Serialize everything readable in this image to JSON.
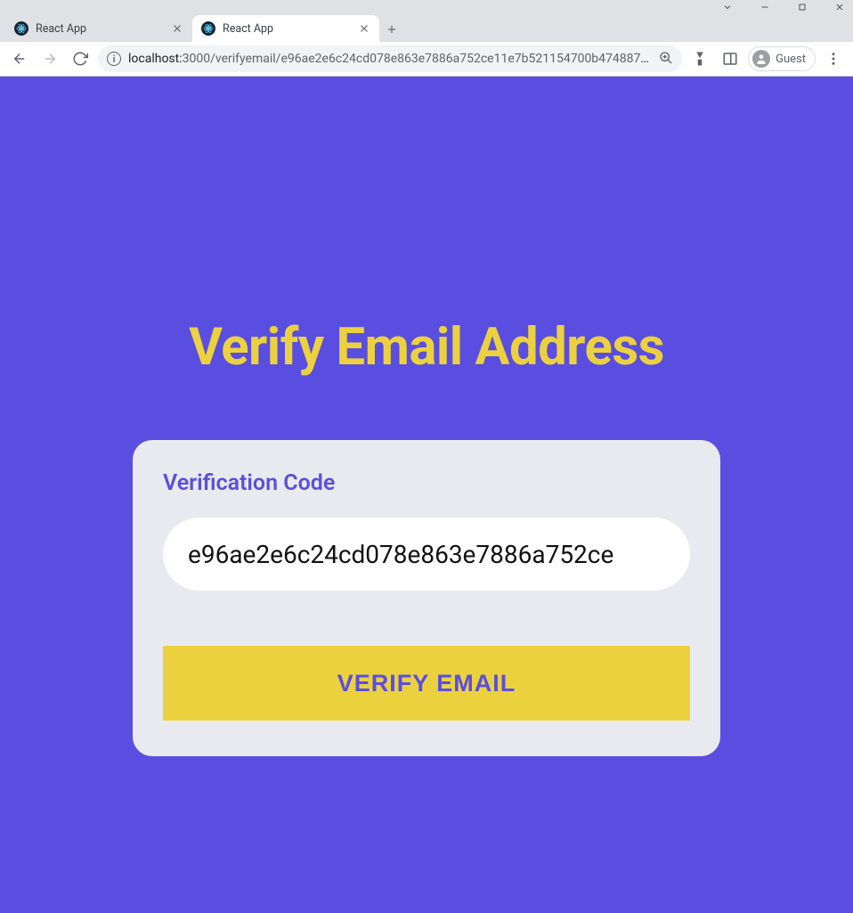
{
  "browser": {
    "tabs": [
      {
        "title": "React App",
        "active": false
      },
      {
        "title": "React App",
        "active": true
      }
    ],
    "url_host": "localhost:",
    "url_port_path": "3000/verifyemail/e96ae2e6c24cd078e863e7886a752ce11e7b521154700b4748872e3...",
    "profile_label": "Guest"
  },
  "page": {
    "title": "Verify Email Address",
    "form": {
      "label": "Verification Code",
      "code_value": "e96ae2e6c24cd078e863e7886a752ce",
      "button_label": "VERIFY EMAIL"
    }
  }
}
